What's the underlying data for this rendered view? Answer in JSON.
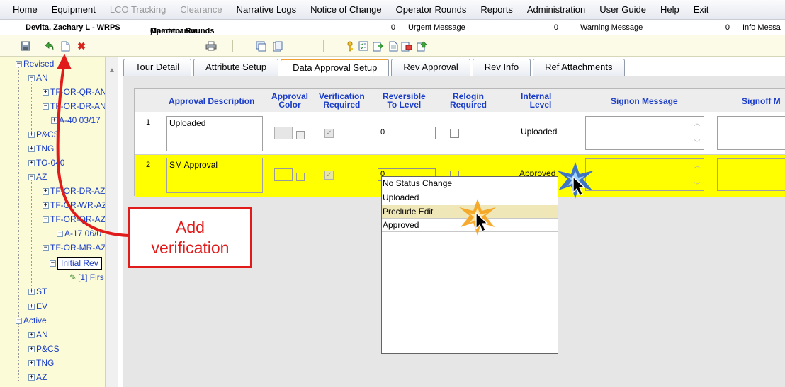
{
  "menu": {
    "items": [
      {
        "label": "Home",
        "disabled": false
      },
      {
        "label": "Equipment",
        "disabled": false
      },
      {
        "label": "LCO Tracking",
        "disabled": true
      },
      {
        "label": "Clearance",
        "disabled": true
      },
      {
        "label": "Narrative Logs",
        "disabled": false
      },
      {
        "label": "Notice of Change",
        "disabled": false
      },
      {
        "label": "Operator Rounds",
        "disabled": false
      },
      {
        "label": "Reports",
        "disabled": false
      },
      {
        "label": "Administration",
        "disabled": false
      },
      {
        "label": "User Guide",
        "disabled": false
      },
      {
        "label": "Help",
        "disabled": false
      },
      {
        "label": "Exit",
        "disabled": false
      }
    ]
  },
  "status": {
    "user": "Devita, Zachary L - WRPS",
    "module_a": "Operator Rounds",
    "module_slash": "/",
    "module_b": " Maintenance",
    "urgent_count": "0",
    "urgent_label": "Urgent Message",
    "warning_count": "0",
    "warning_label": "Warning Message",
    "info_count": "0",
    "info_label": "Info Messa"
  },
  "toolbar": {
    "icons": [
      "save-icon",
      "undo-icon",
      "new-document-icon",
      "delete-icon",
      "print-icon",
      "copy-icon",
      "paste-icon",
      "key-icon",
      "checklist-icon",
      "export-icon",
      "document-icon",
      "mail-icon",
      "upload-icon"
    ],
    "delete_glyph": "✖"
  },
  "tree": {
    "nodes": [
      {
        "label": "Revised",
        "pm": "−"
      },
      {
        "label": "AN",
        "pm": "−"
      },
      {
        "label": "TF-OR-QR-AN",
        "pm": "+"
      },
      {
        "label": "TF-OR-DR-AN",
        "pm": "−"
      },
      {
        "label": "A-40 03/17",
        "pm": "+"
      },
      {
        "label": "P&CS",
        "pm": "+"
      },
      {
        "label": "TNG",
        "pm": "+"
      },
      {
        "label": "TO-040",
        "pm": "+"
      },
      {
        "label": "AZ",
        "pm": "−"
      },
      {
        "label": "TF-OR-DR-AZ",
        "pm": "+"
      },
      {
        "label": "TF-OR-WR-AZ",
        "pm": "+"
      },
      {
        "label": "TF-OR-QR-AZ",
        "pm": "−"
      },
      {
        "label": "A-17 06/0",
        "pm": "+"
      },
      {
        "label": "TF-OR-MR-AZ",
        "pm": "−"
      },
      {
        "label": "Initial Rev",
        "pm": "−"
      },
      {
        "label": "[1] Firs",
        "pm": ""
      },
      {
        "label": "ST",
        "pm": "+"
      },
      {
        "label": "EV",
        "pm": "+"
      },
      {
        "label": "Active",
        "pm": "−"
      },
      {
        "label": "AN",
        "pm": "+"
      },
      {
        "label": "P&CS",
        "pm": "+"
      },
      {
        "label": "TNG",
        "pm": "+"
      },
      {
        "label": "AZ",
        "pm": "+"
      }
    ]
  },
  "tabs": [
    {
      "label": "Tour Detail",
      "active": false
    },
    {
      "label": "Attribute Setup",
      "active": false
    },
    {
      "label": "Data Approval Setup",
      "active": true
    },
    {
      "label": "Rev Approval",
      "active": false
    },
    {
      "label": "Rev Info",
      "active": false
    },
    {
      "label": "Ref Attachments",
      "active": false
    }
  ],
  "grid": {
    "headers": {
      "approval_description": "Approval Description",
      "approval_color_1": "Approval",
      "approval_color_2": "Color",
      "verification_1": "Verification",
      "verification_2": "Required",
      "reversible_1": "Reversible",
      "reversible_2": "To Level",
      "relogin_1": "Relogin",
      "relogin_2": "Required",
      "internal_1": "Internal",
      "internal_2": "Level",
      "signon": "Signon Message",
      "signoff": "Signoff M"
    },
    "rows": [
      {
        "num": "1",
        "description": "Uploaded",
        "verification_checked": true,
        "reversible": "0",
        "relogin_checked": false,
        "internal_level": "Uploaded"
      },
      {
        "num": "2",
        "description": "SM Approval",
        "verification_checked": true,
        "reversible": "0",
        "relogin_checked": false,
        "internal_level": "Approved"
      }
    ],
    "highlight_color": "#ffff00"
  },
  "dropdown": {
    "options": [
      "No Status Change",
      "Uploaded",
      "Preclude Edit",
      "Approved"
    ],
    "highlighted": "Preclude Edit"
  },
  "callout": {
    "line1": "Add",
    "line2": "verification",
    "color": "#e11a1a"
  }
}
